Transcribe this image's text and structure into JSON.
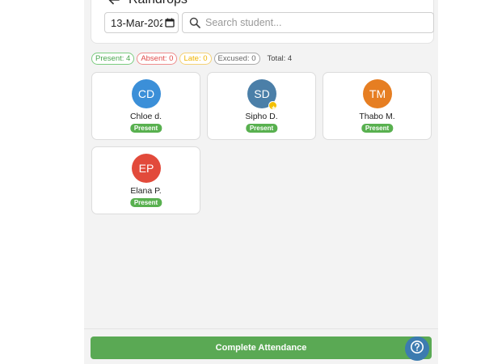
{
  "header": {
    "class_title": "Raindrops",
    "date_value": "13-Mar-2025",
    "search_placeholder": "Search student..."
  },
  "summary": {
    "present_label": "Present: 4",
    "absent_label": "Absent: 0",
    "late_label": "Late: 0",
    "excused_label": "Excused: 0",
    "total_label": "Total: 4"
  },
  "students": [
    {
      "initials": "CD",
      "name": "Chloe d.",
      "status": "Present",
      "avatar_color": "#3b8fd8"
    },
    {
      "initials": "SD",
      "name": "Sipho D.",
      "status": "Present",
      "avatar_color": "#4b7fa8",
      "badge": "star-badge"
    },
    {
      "initials": "TM",
      "name": "Thabo M.",
      "status": "Present",
      "avatar_color": "#e67e22"
    },
    {
      "initials": "EP",
      "name": "Elana P.",
      "status": "Present",
      "avatar_color": "#e24a3b"
    }
  ],
  "footer": {
    "complete_label": "Complete Attendance"
  },
  "colors": {
    "present": "#58b04f",
    "absent": "#e04a4a",
    "late": "#f0b400",
    "excused": "#888888",
    "primary_button": "#5aa954",
    "help_button": "#3c7bb0"
  },
  "icons": {
    "back": "arrow-left-icon",
    "calendar": "calendar-icon",
    "search": "search-icon",
    "help": "help-circle-icon"
  }
}
